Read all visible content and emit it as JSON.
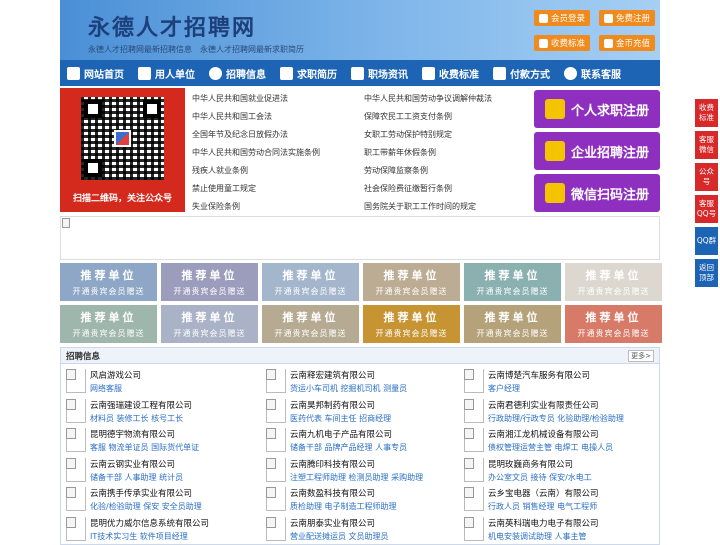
{
  "site": {
    "title": "永德人才招聘网",
    "tagline": "永德人才招聘网最新招聘信息　永德人才招聘网最新求职简历"
  },
  "header_buttons": {
    "login": "会员登录",
    "register": "免费注册",
    "fees": "收费标准",
    "recharge": "金币充值"
  },
  "nav": [
    {
      "label": "网站首页",
      "icon": "home-icon"
    },
    {
      "label": "用人单位",
      "icon": "building-icon"
    },
    {
      "label": "招聘信息",
      "icon": "recruit-icon"
    },
    {
      "label": "求职简历",
      "icon": "resume-icon"
    },
    {
      "label": "职场资讯",
      "icon": "news-icon"
    },
    {
      "label": "收费标准",
      "icon": "fees-icon"
    },
    {
      "label": "付款方式",
      "icon": "payment-icon"
    },
    {
      "label": "联系客服",
      "icon": "service-icon"
    }
  ],
  "qr": {
    "caption": "扫描二维码，关注公众号"
  },
  "laws": [
    "中华人民共和国就业促进法",
    "中华人民共和国劳动争议调解仲裁法",
    "中华人民共和国工会法",
    "保障农民工工资支付条例",
    "全国年节及纪念日放假办法",
    "女职工劳动保护特别规定",
    "中华人民共和国劳动合同法实施条例",
    "职工带薪年休假条例",
    "残疾人就业条例",
    "劳动保障监察条例",
    "禁止使用童工规定",
    "社会保险费征缴暂行条例",
    "失业保险条例",
    "国务院关于职工工作时间的规定"
  ],
  "register_buttons": {
    "personal": "个人求职注册",
    "company": "企业招聘注册",
    "wechat": "微信扫码注册"
  },
  "units": {
    "title": "推荐单位",
    "subtitle": "开通贵宾会员赠送",
    "colors": [
      "#8fa7c7",
      "#9c9cbd",
      "#a3b6cc",
      "#bcac93",
      "#8bb0b0",
      "#dcd8cf",
      "#9eb6ab",
      "#aab2c7",
      "#b6ab92",
      "#c79433",
      "#b5a27a",
      "#d77a67"
    ]
  },
  "jobs": {
    "title": "招聘信息",
    "more": "更多>",
    "items": [
      {
        "company": "风启游戏公司",
        "positions": "网络客服"
      },
      {
        "company": "云南释宏建筑有限公司",
        "positions": "货运小车司机 挖掘机司机 测量员"
      },
      {
        "company": "云南博楚汽车服务有限公司",
        "positions": "客户经理"
      },
      {
        "company": "云南强瑞建设工程有限公司",
        "positions": "材料员 装修工长 核号工长"
      },
      {
        "company": "云南昊邦制药有限公司",
        "positions": "医药代表 车间主任 招商经理"
      },
      {
        "company": "云南君德利实业有限责任公司",
        "positions": "行政助理/行政专员 化验助理/检验助理"
      },
      {
        "company": "昆明德宇物流有限公司",
        "positions": "客服 物流单证员 国际货代单证"
      },
      {
        "company": "云南九机电子产品有限公司",
        "positions": "储备干部 品牌产品经理 人事专员"
      },
      {
        "company": "云南湘江龙机械设备有限公司",
        "positions": "债权管理运营主管 电焊工 电操人员"
      },
      {
        "company": "云南云钢实业有限公司",
        "positions": "储备干部 人事助理 统计员"
      },
      {
        "company": "云南腾印科技有限公司",
        "positions": "注塑工程师助理 检测员助理 采购助理"
      },
      {
        "company": "昆明玫巍商务有限公司",
        "positions": "办公室文员 接待 保安/水电工"
      },
      {
        "company": "云南携手传承实业有限公司",
        "positions": "化验/检验助理 保安 安全员助理"
      },
      {
        "company": "云南数盈科技有限公司",
        "positions": "质检助理 电子制造工程师助理"
      },
      {
        "company": "云乡宝电器（云南）有限公司",
        "positions": "行政人员 销售经理 电气工程师"
      },
      {
        "company": "昆明优力威尔信息系统有限公司",
        "positions": "IT技术实习生 软件项目经理"
      },
      {
        "company": "云南朋泰实业有限公司",
        "positions": "营业配送摊运员 文员助理员"
      },
      {
        "company": "云南英科瑞电力电子有限公司",
        "positions": "机电安装调试助理 人事主管"
      }
    ]
  },
  "float_bar": [
    {
      "label": "收费标准",
      "color": "#d8292a"
    },
    {
      "label": "客服微信",
      "color": "#d8292a"
    },
    {
      "label": "公众号",
      "color": "#d8292a"
    },
    {
      "label": "客服QQ号",
      "color": "#d8292a"
    },
    {
      "label": "QQ群",
      "color": "#1e64b4"
    },
    {
      "label": "返回顶部",
      "color": "#1e64b4"
    }
  ]
}
